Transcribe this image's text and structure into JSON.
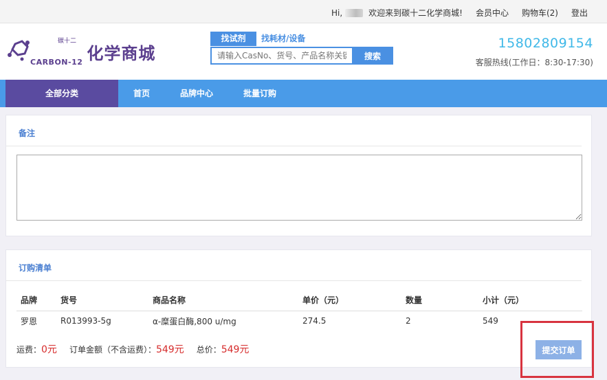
{
  "topbar": {
    "greeting_prefix": "Hi,",
    "greeting_suffix": "欢迎来到碳十二化学商城!",
    "member_center": "会员中心",
    "cart": "购物车(2)",
    "logout": "登出"
  },
  "logo": {
    "small_cn": "碳十二",
    "brand_en": "CARBON-12",
    "title": "化学商城"
  },
  "search": {
    "tab_active": "找试剂",
    "tab_other": "找耗材/设备",
    "placeholder": "请输入CasNo、货号、产品名称关键",
    "button": "搜索"
  },
  "hotline": {
    "phone": "15802809154",
    "hours": "客服热线(工作日：8:30-17:30)"
  },
  "nav": {
    "all_categories": "全部分类",
    "links": [
      "首页",
      "品牌中心",
      "批量订购"
    ]
  },
  "remark": {
    "title": "备注"
  },
  "order": {
    "title": "订购清单",
    "headers": [
      "品牌",
      "货号",
      "商品名称",
      "单价（元）",
      "数量",
      "小计（元）"
    ],
    "rows": [
      [
        "罗恩",
        "R013993-5g",
        "α-糜蛋白酶,800 u/mg",
        "274.5",
        "2",
        "549"
      ]
    ],
    "shipping_label": "运费：",
    "shipping_value": "0元",
    "amount_label": "订单金额（不含运费）：",
    "amount_value": "549元",
    "total_label": "总价：",
    "total_value": "549元",
    "submit": "提交订单"
  },
  "colors": {
    "primary": "#4a90e2",
    "nav_bar": "#4a9be8",
    "category": "#5a4ba0",
    "brand": "#5b3f8e",
    "price_red": "#d62b2b",
    "highlight": "#d8333f"
  }
}
